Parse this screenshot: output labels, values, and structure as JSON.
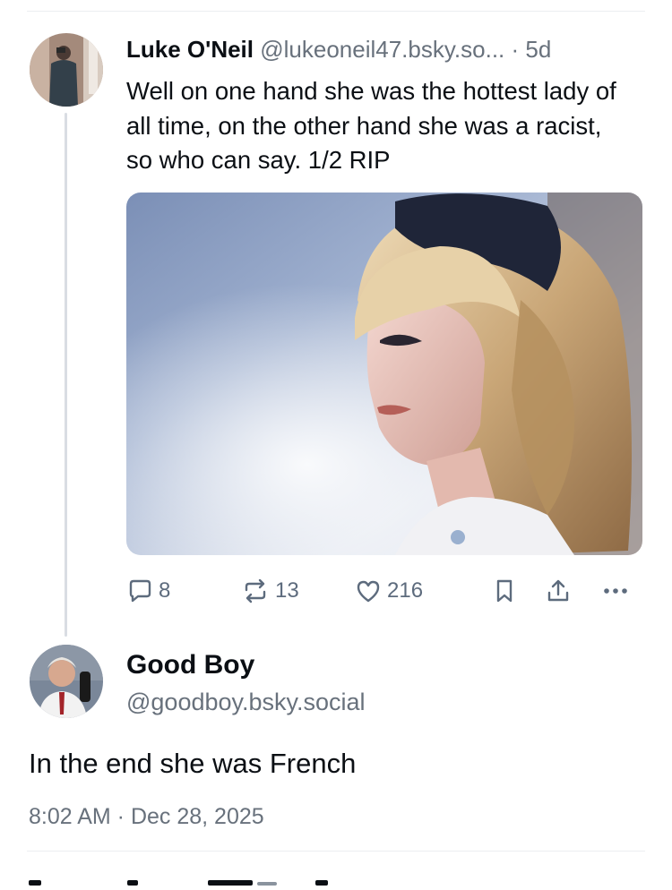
{
  "post": {
    "author_name": "Luke O'Neil",
    "author_handle": "@lukeoneil47.bsky.so...",
    "time": "· 5d",
    "text": "Well on one hand she was the hottest lady of all time, on the other hand she was a racist, so who can say. 1/2 RIP",
    "stats": {
      "replies": "8",
      "reposts": "13",
      "likes": "216"
    },
    "icons": [
      "reply-icon",
      "repost-icon",
      "like-icon",
      "bookmark-icon",
      "share-icon",
      "more-icon"
    ]
  },
  "reply": {
    "author_name": "Good Boy",
    "author_handle": "@goodboy.bsky.social",
    "text": "In the end she was French",
    "timestamp": "8:02 AM · Dec 28, 2025"
  },
  "colors": {
    "text": "#0b0f14",
    "muted": "#68717c",
    "icon": "#5d6b7d",
    "divider": "#eceef1"
  }
}
